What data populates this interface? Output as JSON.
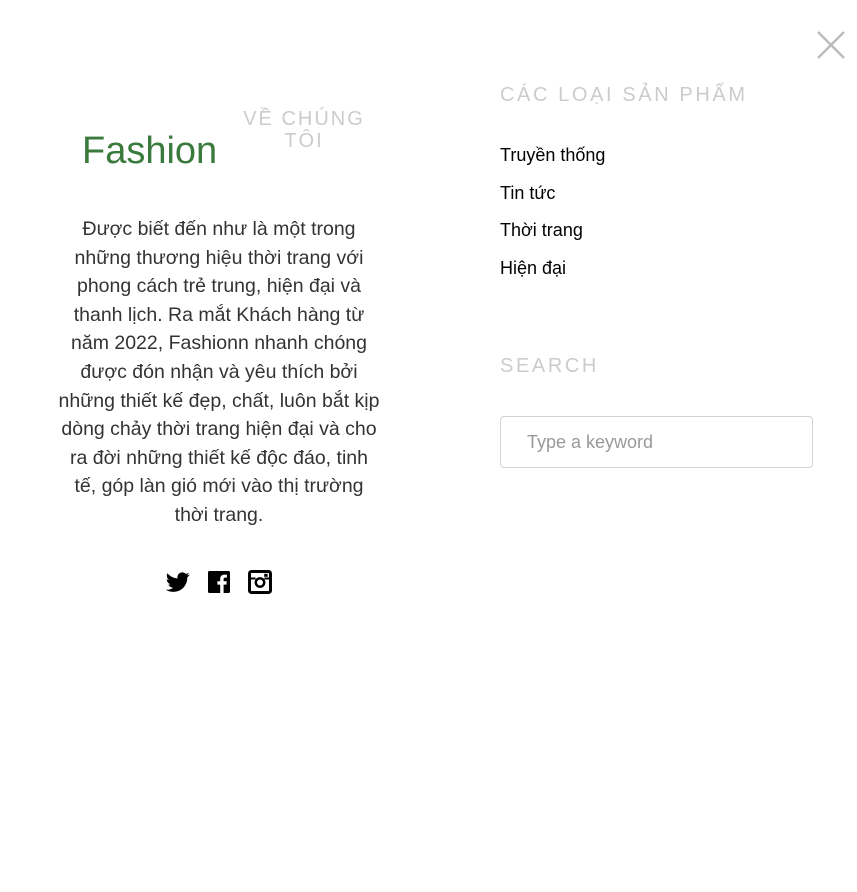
{
  "close": {
    "icon": "close-icon"
  },
  "about": {
    "brand": "Fashion",
    "heading": "Về chúng tôi",
    "text": "Được biết đến như là một trong những thương hiệu thời trang với phong cách trẻ trung, hiện đại và thanh lịch. Ra mắt Khách hàng từ năm 2022, Fashionn nhanh chóng được đón nhận và yêu thích bởi những thiết kế đẹp, chất, luôn bắt kịp dòng chảy thời trang hiện đại và cho ra đời những thiết kế độc đáo, tinh tế, góp làn gió mới vào thị trường thời trang.",
    "social": [
      {
        "icon": "twitter-icon"
      },
      {
        "icon": "facebook-icon"
      },
      {
        "icon": "instagram-icon"
      }
    ]
  },
  "categories": {
    "heading": "Các loại sản phẩm",
    "items": [
      "Truyền thống",
      "Tin tức",
      "Thời trang",
      "Hiện đại"
    ]
  },
  "search": {
    "heading": "Search",
    "placeholder": "Type a keyword"
  },
  "colors": {
    "brand": "#3a7a3d",
    "heading_muted": "#cccccc",
    "body_text": "#333333"
  }
}
